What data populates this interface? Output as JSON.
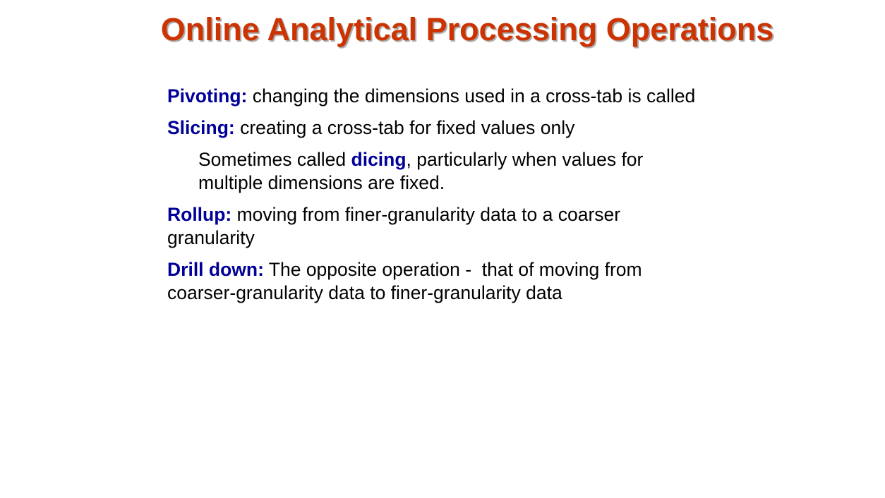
{
  "title": "Online Analytical Processing Operations",
  "accent_colors": {
    "title": "#cc3300",
    "term": "#000099"
  },
  "items": [
    {
      "term": "Pivoting:",
      "text": " changing the dimensions used in a cross-tab is called"
    },
    {
      "term": "Slicing:",
      "text": " creating a cross-tab for fixed values only"
    },
    {
      "pre": "Sometimes called ",
      "term": "dicing",
      "post": ", particularly when values for multiple dimensions are fixed."
    },
    {
      "term": "Rollup:",
      "text": " moving from finer-granularity data to a coarser granularity"
    },
    {
      "term": "Drill down:",
      "text": " The opposite operation -  that of moving from coarser-granularity data to finer-granularity data"
    }
  ]
}
